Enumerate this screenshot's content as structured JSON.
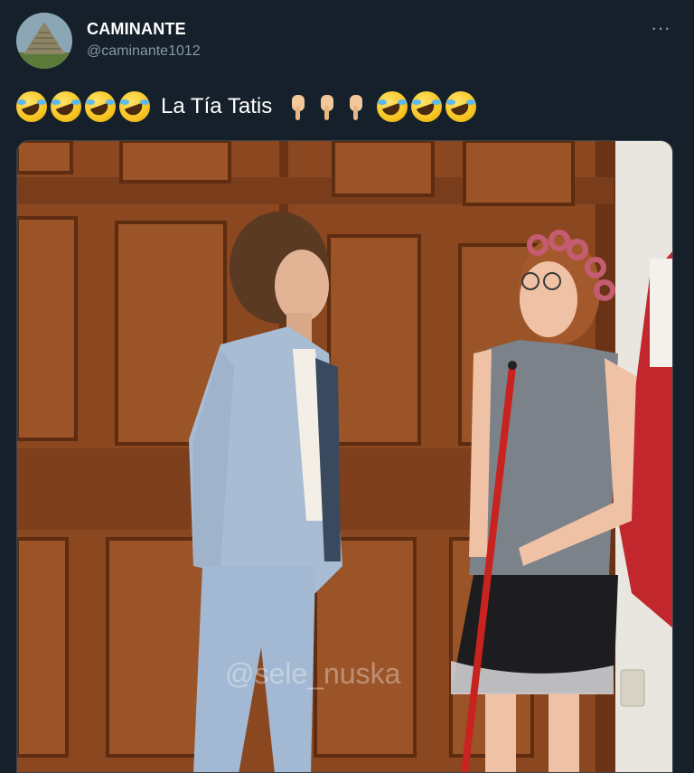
{
  "author": {
    "display_name": "CAMINANTE",
    "handle": "@caminante1012",
    "avatar_icon": "pyramid-photo-avatar"
  },
  "menu": {
    "more_icon": "ellipsis-icon",
    "label": "···"
  },
  "tweet": {
    "text": "La Tía Tatis",
    "leading_emoji": [
      "rolling-on-floor-laughing",
      "rolling-on-floor-laughing",
      "rolling-on-floor-laughing",
      "rolling-on-floor-laughing"
    ],
    "pointing_emoji": [
      "backhand-index-pointing-down",
      "backhand-index-pointing-down",
      "backhand-index-pointing-down"
    ],
    "trailing_emoji": [
      "rolling-on-floor-laughing",
      "rolling-on-floor-laughing",
      "rolling-on-floor-laughing"
    ]
  },
  "media": {
    "watermark": "@sele_nuska",
    "colors": {
      "wood": "#8a4720",
      "wood_dark": "#6a3315",
      "wall": "#e9e6df",
      "flag_red": "#c1272d"
    }
  }
}
